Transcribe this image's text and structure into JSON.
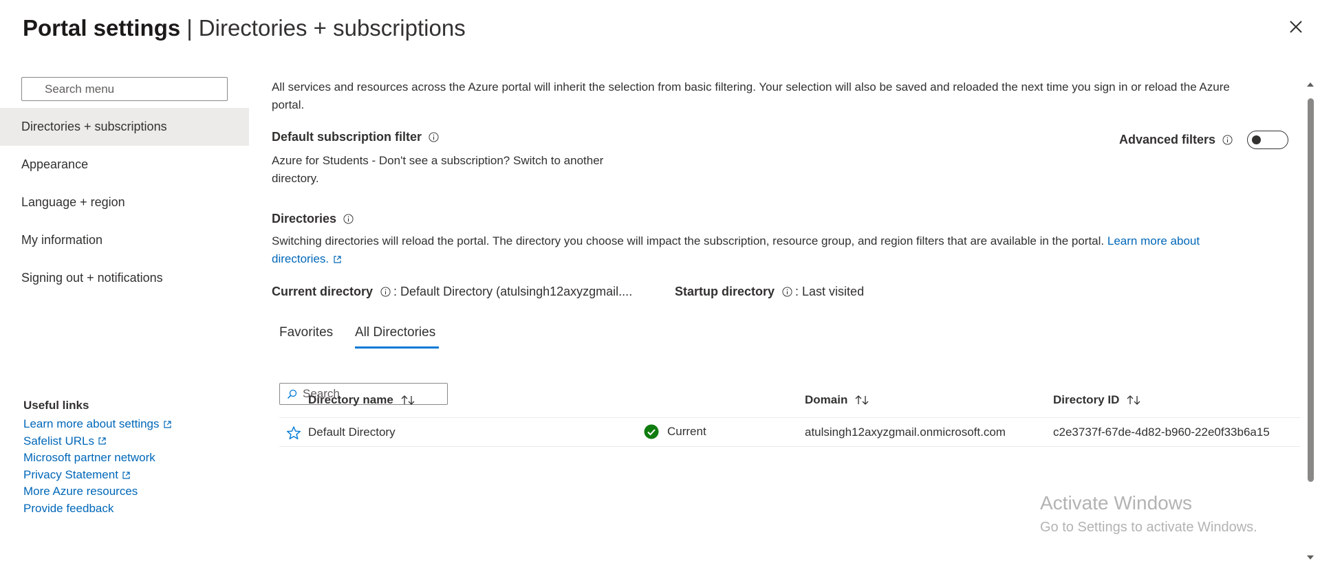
{
  "header": {
    "title_bold": "Portal settings",
    "separator": "|",
    "title": "Directories + subscriptions"
  },
  "sidebar": {
    "search_placeholder": "Search menu",
    "items": [
      {
        "label": "Directories + subscriptions",
        "active": true
      },
      {
        "label": "Appearance"
      },
      {
        "label": "Language + region"
      },
      {
        "label": "My information"
      },
      {
        "label": "Signing out + notifications"
      }
    ],
    "useful_links": {
      "title": "Useful links",
      "links": [
        {
          "label": "Learn more about settings",
          "external": true
        },
        {
          "label": "Safelist URLs",
          "external": true
        },
        {
          "label": "Microsoft partner network",
          "external": false
        },
        {
          "label": "Privacy Statement",
          "external": true
        },
        {
          "label": "More Azure resources",
          "external": false
        },
        {
          "label": "Provide feedback",
          "external": false
        }
      ]
    }
  },
  "main": {
    "intro_line1": "All services and resources across the Azure portal will inherit the selection from basic filtering. Your selection will also be saved and reloaded the next time you sign in or reload the Azure",
    "intro_line2": "portal.",
    "default_filter": {
      "label": "Default subscription filter",
      "line1": "Azure for Students - Don't see a subscription? Switch to another",
      "line2": "directory."
    },
    "advanced_filters": {
      "label": "Advanced filters",
      "on": false
    },
    "directories": {
      "label": "Directories",
      "desc_line1": "Switching directories will reload the portal. The directory you choose will impact the subscription, resource group, and region filters that are available in the portal.",
      "learn_more_1": "Learn more about",
      "learn_more_2": "directories."
    },
    "current_directory": {
      "label": "Current directory",
      "value": ": Default Directory (atulsingh12axyzgmail...."
    },
    "startup_directory": {
      "label": "Startup directory",
      "value": ": Last visited"
    },
    "tabs": [
      {
        "label": "Favorites",
        "active": false
      },
      {
        "label": "All Directories",
        "active": true
      }
    ],
    "table_search_placeholder": "Search",
    "table": {
      "headers": {
        "name": "Directory name",
        "domain": "Domain",
        "id": "Directory ID"
      },
      "rows": [
        {
          "name": "Default Directory",
          "status": "Current",
          "domain": "atulsingh12axyzgmail.onmicrosoft.com",
          "id": "c2e3737f-67de-4d82-b960-22e0f33b6a15"
        }
      ]
    }
  },
  "watermark": {
    "line1": "Activate Windows",
    "line2": "Go to Settings to activate Windows."
  },
  "colors": {
    "accent": "#0078d4",
    "link": "#0067b8",
    "success": "#107c10",
    "nav_active": "#edebe9"
  }
}
